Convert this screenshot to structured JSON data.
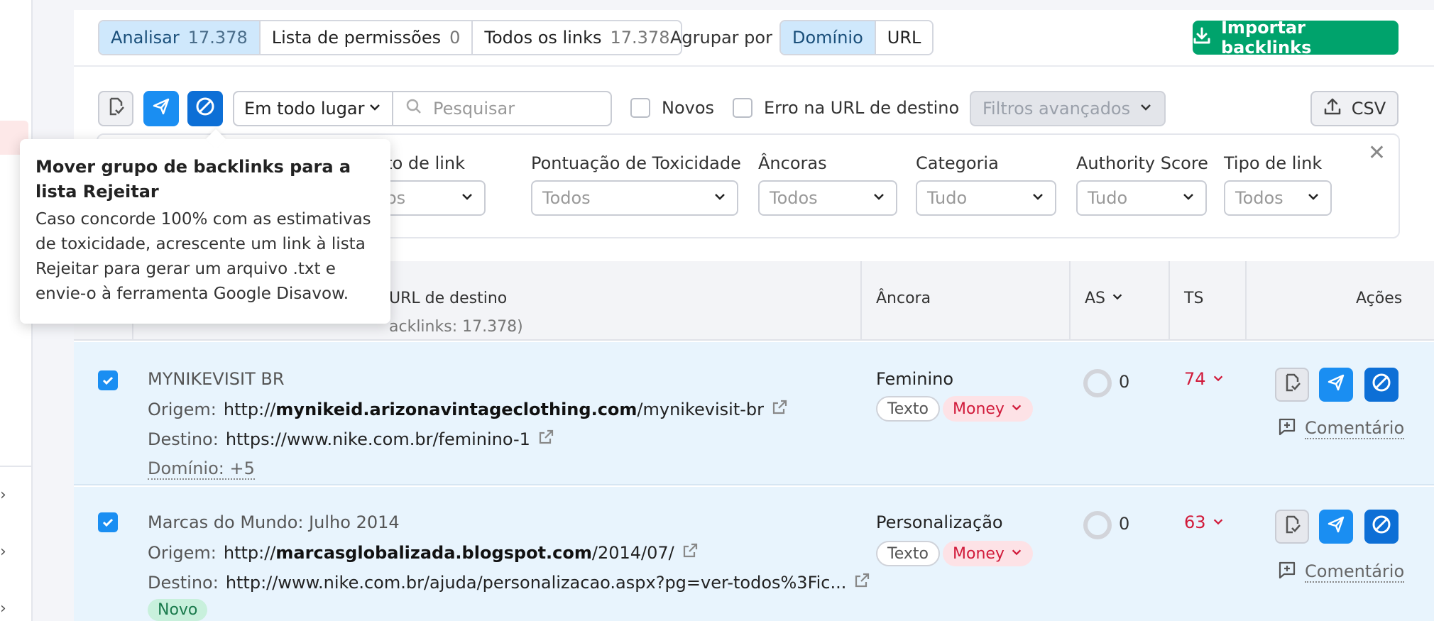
{
  "tabs": [
    {
      "label": "Analisar",
      "count": "17.378"
    },
    {
      "label": "Lista de permissões",
      "count": "0"
    },
    {
      "label": "Todos os links",
      "count": "17.378"
    }
  ],
  "group_by": {
    "label": "Agrupar por",
    "options": [
      "Domínio",
      "URL"
    ]
  },
  "import_button": "Importar backlinks",
  "toolbar": {
    "location_select": "Em todo lugar",
    "search_placeholder": "Pesquisar",
    "check_new": "Novos",
    "check_error": "Erro na URL de destino",
    "advanced_filters": "Filtros avançados",
    "csv": "CSV"
  },
  "filters": [
    {
      "label": "Atributo de link",
      "visible_label": "uto de link",
      "value": "Todos",
      "visible_value": "os"
    },
    {
      "label": "Pontuação de Toxicidade",
      "value": "Todos"
    },
    {
      "label": "Âncoras",
      "value": "Todos"
    },
    {
      "label": "Categoria",
      "value": "Tudo"
    },
    {
      "label": "Authority Score",
      "value": "Tudo"
    },
    {
      "label": "Tipo de link",
      "value": "Todos"
    }
  ],
  "table_header": {
    "col_url": "URL de destino",
    "col_url_sub": "acklinks: 17.378)",
    "col_anchor": "Âncora",
    "col_as": "AS",
    "col_ts": "TS",
    "col_actions": "Ações"
  },
  "rows": [
    {
      "title": "MYNIKEVISIT BR",
      "origin_label": "Origem:",
      "origin_prefix": "http://",
      "origin_domain": "mynikeid.arizonavintageclothing.com",
      "origin_path": "/mynikevisit-br",
      "dest_label": "Destino:",
      "dest_url": "https://www.nike.com.br/feminino-1",
      "domain_more": "Domínio: +5",
      "anchor": "Feminino",
      "tag_type": "Texto",
      "tag_money": "Money",
      "as": "0",
      "ts": "74",
      "comment": "Comentário"
    },
    {
      "title": "Marcas do Mundo: Julho 2014",
      "origin_label": "Origem:",
      "origin_prefix": "http://",
      "origin_domain": "marcasglobalizada.blogspot.com",
      "origin_path": "/2014/07/",
      "dest_label": "Destino:",
      "dest_url": "http://www.nike.com.br/ajuda/personalizacao.aspx?pg=ver-todos%3Fic...",
      "badge": "Novo",
      "anchor": "Personalização",
      "tag_type": "Texto",
      "tag_money": "Money",
      "as": "0",
      "ts": "63",
      "comment": "Comentário"
    }
  ],
  "tooltip": {
    "title": "Mover grupo de backlinks para a lista Rejeitar",
    "body": "Caso concorde 100% com as estimativas de toxicidade, acrescente um link à lista Rejeitar para gerar um arquivo .txt e envie-o à ferramenta Google Disavow."
  },
  "colors": {
    "accent_blue": "#1a8ef2",
    "import_green": "#00a36c",
    "toxic_red": "#d11a3a",
    "selected_row": "#e8f4fd"
  }
}
